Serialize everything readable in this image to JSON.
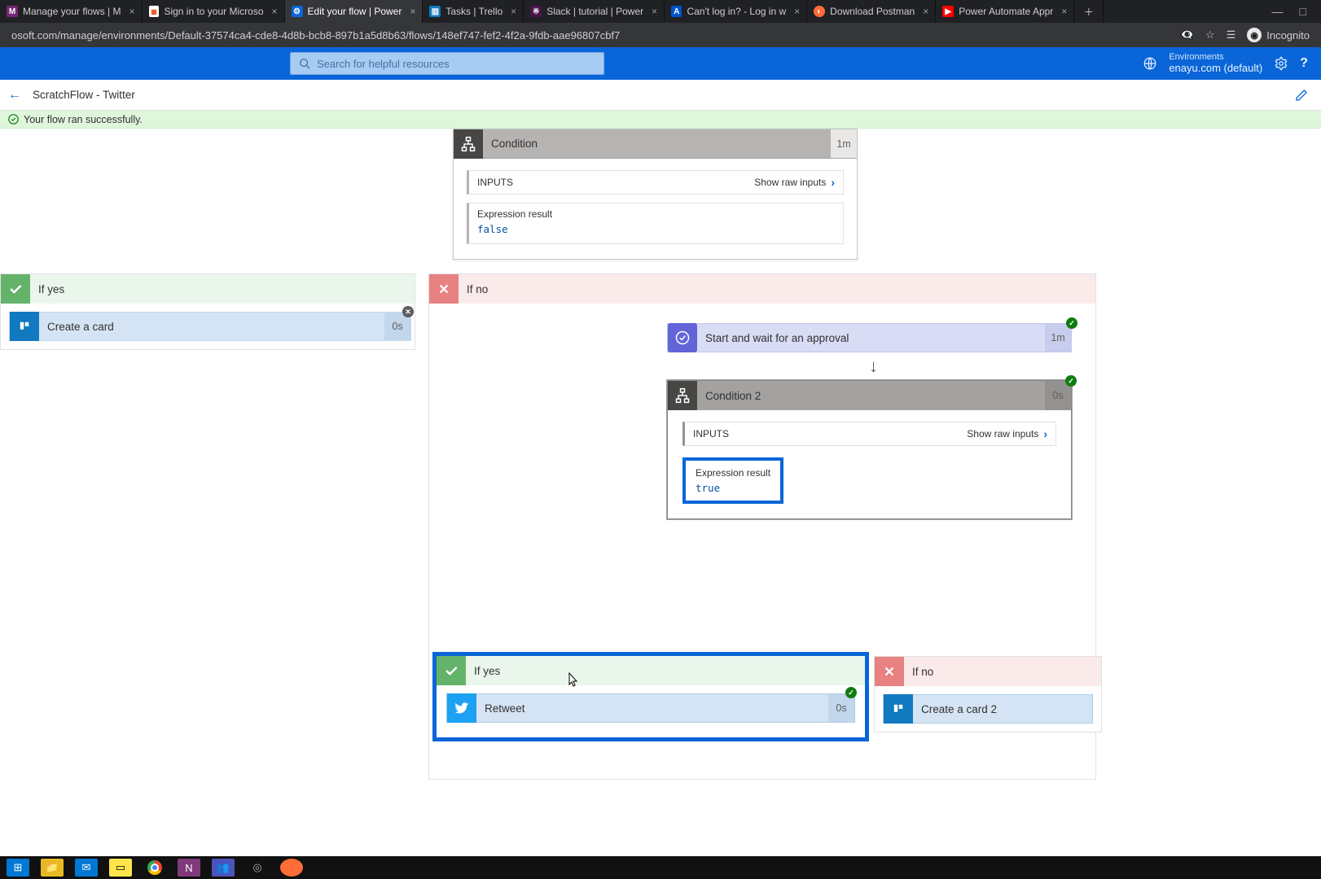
{
  "tabs": [
    {
      "title": "Manage your flows | M"
    },
    {
      "title": "Sign in to your Microso"
    },
    {
      "title": "Edit your flow | Power"
    },
    {
      "title": "Tasks | Trello"
    },
    {
      "title": "Slack | tutorial | Power"
    },
    {
      "title": "Can't log in? - Log in w"
    },
    {
      "title": "Download Postman"
    },
    {
      "title": "Power Automate Appr"
    }
  ],
  "addr": {
    "url": "osoft.com/manage/environments/Default-37574ca4-cde8-4d8b-bcb8-897b1a5d8b63/flows/148ef747-fef2-4f2a-9fdb-aae96807cbf7",
    "incognito": "Incognito"
  },
  "appbar": {
    "search_placeholder": "Search for helpful resources",
    "env_label": "Environments",
    "env_value": "enayu.com (default)"
  },
  "breadcrumb": {
    "title": "ScratchFlow - Twitter"
  },
  "banner": {
    "text": "Your flow ran successfully."
  },
  "cond1": {
    "title": "Condition",
    "duration": "1m",
    "inputs_label": "INPUTS",
    "raw": "Show raw inputs",
    "expr_label": "Expression result",
    "expr_value": "false"
  },
  "ifyes1": {
    "title": "If yes",
    "card": "Create a card",
    "duration": "0s"
  },
  "ifno1": {
    "title": "If no"
  },
  "approval": {
    "title": "Start and wait for an approval",
    "duration": "1m"
  },
  "cond2": {
    "title": "Condition 2",
    "duration": "0s",
    "inputs_label": "INPUTS",
    "raw": "Show raw inputs",
    "expr_label": "Expression result",
    "expr_value": "true"
  },
  "ifyes2": {
    "title": "If yes",
    "card": "Retweet",
    "duration": "0s"
  },
  "ifno2": {
    "title": "If no",
    "card": "Create a card 2"
  }
}
